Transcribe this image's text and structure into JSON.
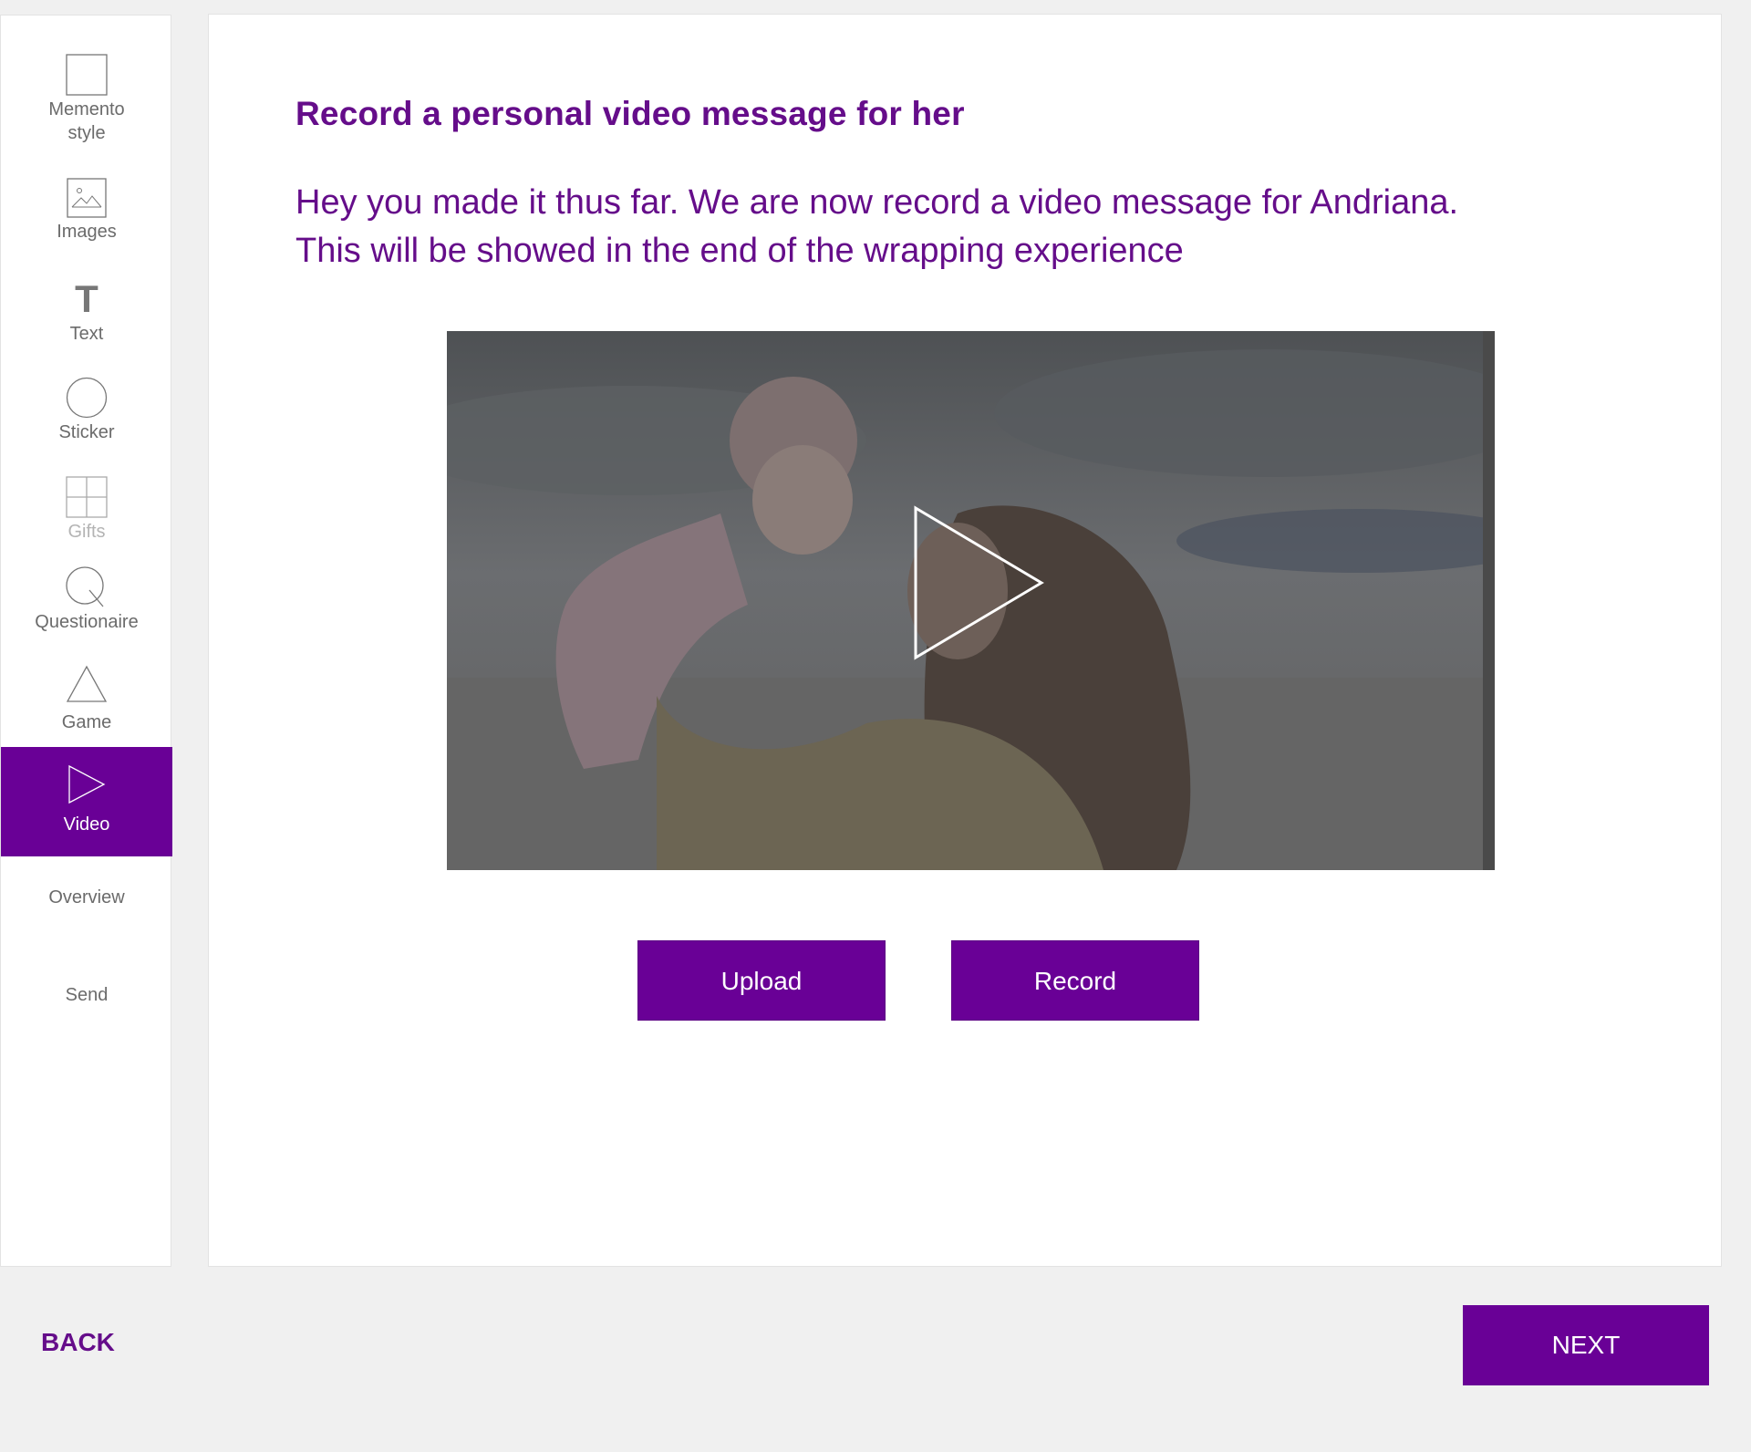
{
  "sidebar": {
    "items": [
      {
        "label": "Memento\nstyle",
        "icon": "square-icon",
        "state": "normal"
      },
      {
        "label": "Images",
        "icon": "image-icon",
        "state": "normal"
      },
      {
        "label": "Text",
        "icon": "text-icon",
        "state": "normal"
      },
      {
        "label": "Sticker",
        "icon": "circle-icon",
        "state": "normal"
      },
      {
        "label": "Gifts",
        "icon": "grid-icon",
        "state": "disabled"
      },
      {
        "label": "Questionaire",
        "icon": "magnifier-icon",
        "state": "normal"
      },
      {
        "label": "Game",
        "icon": "triangle-icon",
        "state": "normal"
      },
      {
        "label": "Video",
        "icon": "play-icon",
        "state": "active"
      },
      {
        "label": "Overview",
        "icon": "",
        "state": "normal"
      },
      {
        "label": "Send",
        "icon": "",
        "state": "normal"
      }
    ]
  },
  "main": {
    "title": "Record a personal video message for her",
    "description": "Hey you made it thus far. We are now record a video message for Andriana. This will be showed in the end of the wrapping experience",
    "video": {
      "play_icon": "play-icon"
    },
    "upload_label": "Upload",
    "record_label": "Record"
  },
  "footer": {
    "back_label": "BACK",
    "next_label": "NEXT"
  },
  "colors": {
    "accent": "#690096",
    "title_text": "#650d8a",
    "background": "#f0f0f0"
  }
}
